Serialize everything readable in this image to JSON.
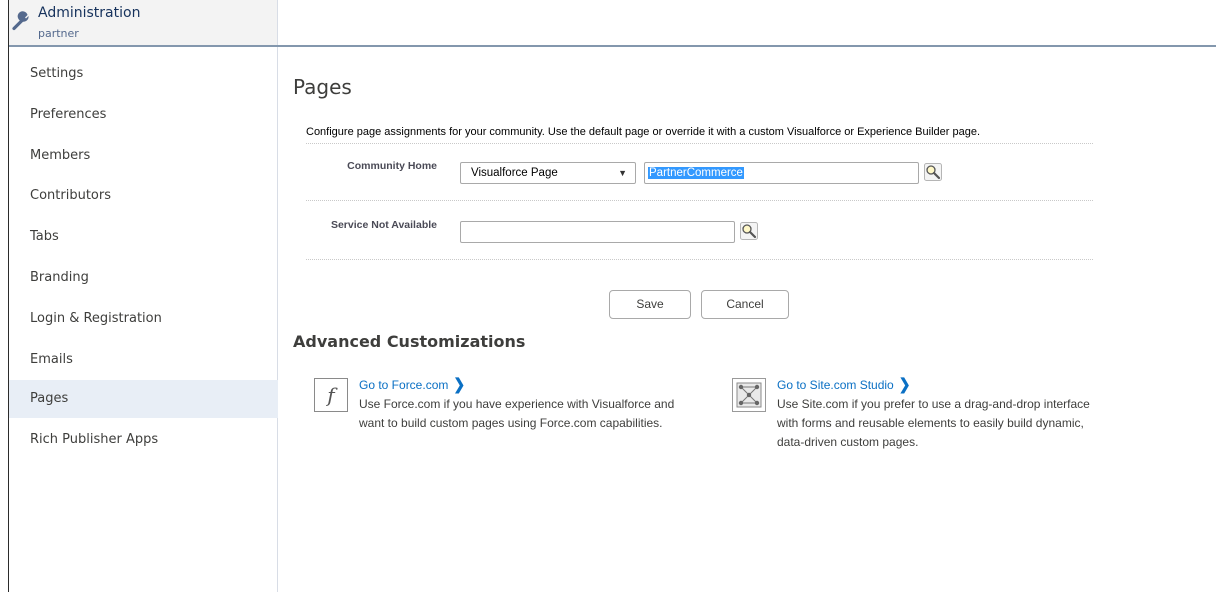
{
  "header": {
    "title": "Administration",
    "subtitle": "partner"
  },
  "sidebar": {
    "items": [
      {
        "label": "Settings"
      },
      {
        "label": "Preferences"
      },
      {
        "label": "Members"
      },
      {
        "label": "Contributors"
      },
      {
        "label": "Tabs"
      },
      {
        "label": "Branding"
      },
      {
        "label": "Login & Registration"
      },
      {
        "label": "Emails"
      },
      {
        "label": "Pages",
        "active": true
      },
      {
        "label": "Rich Publisher Apps"
      }
    ]
  },
  "main": {
    "title": "Pages",
    "description": "Configure page assignments for your community. Use the default page or override it with a custom Visualforce or Experience Builder page.",
    "community_home": {
      "label": "Community Home",
      "select_value": "Visualforce Page",
      "input_value": "PartnerCommerce"
    },
    "service_not_available": {
      "label": "Service Not Available",
      "input_value": ""
    },
    "save_label": "Save",
    "cancel_label": "Cancel",
    "advanced": {
      "title": "Advanced Customizations",
      "force": {
        "link": "Go to Force.com",
        "text": "Use Force.com if you have experience with Visualforce and want to build custom pages using Force.com capabilities."
      },
      "site": {
        "link": "Go to Site.com Studio",
        "text": "Use Site.com if you prefer to use a drag-and-drop interface with forms and reusable elements to easily build dynamic, data-driven custom pages."
      }
    }
  },
  "colors": {
    "link": "#0b70c4",
    "active_nav": "#e8eef6",
    "header_border": "#8397ad"
  }
}
